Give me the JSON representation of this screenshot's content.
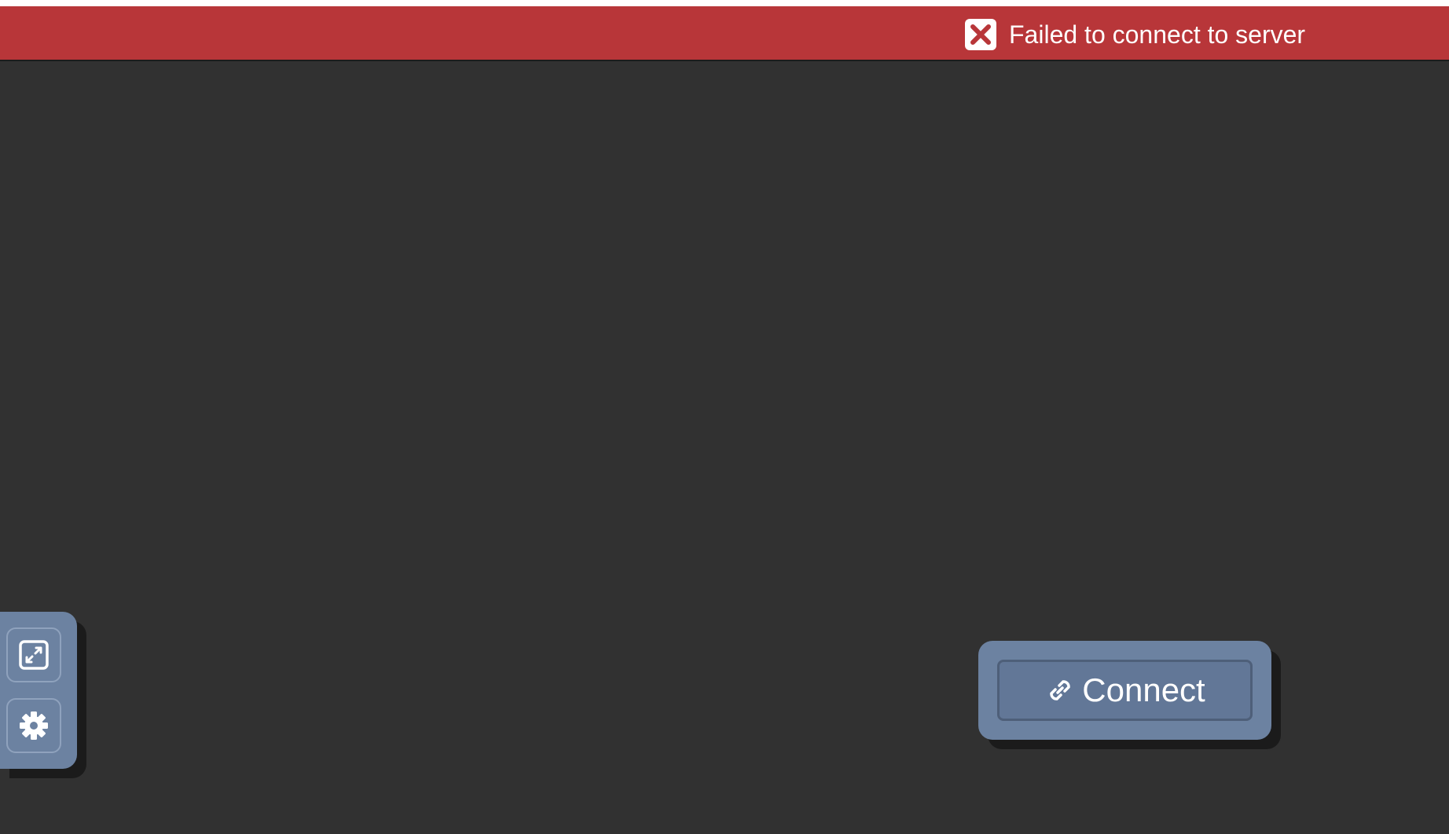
{
  "status": {
    "icon": "close-icon",
    "message": "Failed to connect to server",
    "color": "#b83639"
  },
  "control_bar": {
    "fullscreen": {
      "icon": "fullscreen-icon"
    },
    "settings": {
      "icon": "gear-icon"
    },
    "color": "#6c82a1"
  },
  "connect": {
    "icon": "link-icon",
    "label": "Connect"
  },
  "colors": {
    "background": "#313131",
    "panel": "#6c82a1",
    "error": "#b83639"
  }
}
